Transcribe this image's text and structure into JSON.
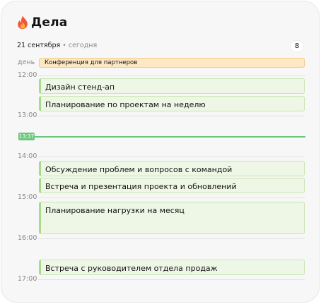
{
  "header": {
    "title": "Дела",
    "icon": "fire-icon"
  },
  "date": {
    "label": "21 сентября",
    "separator": "•",
    "relative": "сегодня",
    "count": "8"
  },
  "allday": {
    "label": "день",
    "event": "Конференция для партнеров"
  },
  "hours": [
    "12:00",
    "13:00",
    "14:00",
    "15:00",
    "16:00",
    "17:00"
  ],
  "now": {
    "time": "13:37"
  },
  "events": [
    {
      "title": "Дизайн стенд-ап"
    },
    {
      "title": "Планирование по проектам на неделю"
    },
    {
      "title": "Обсуждение проблем и вопросов с командой"
    },
    {
      "title": "Встреча и презентация проекта и обновлений"
    },
    {
      "title": "Планирование нагрузки на месяц"
    },
    {
      "title": "Встреча с руководителем отдела продаж"
    }
  ],
  "colors": {
    "event_bg": "#eef7e6",
    "event_accent": "#a9d98a",
    "allday_bg": "#fde8c4",
    "now_indicator": "#6bc77b"
  }
}
